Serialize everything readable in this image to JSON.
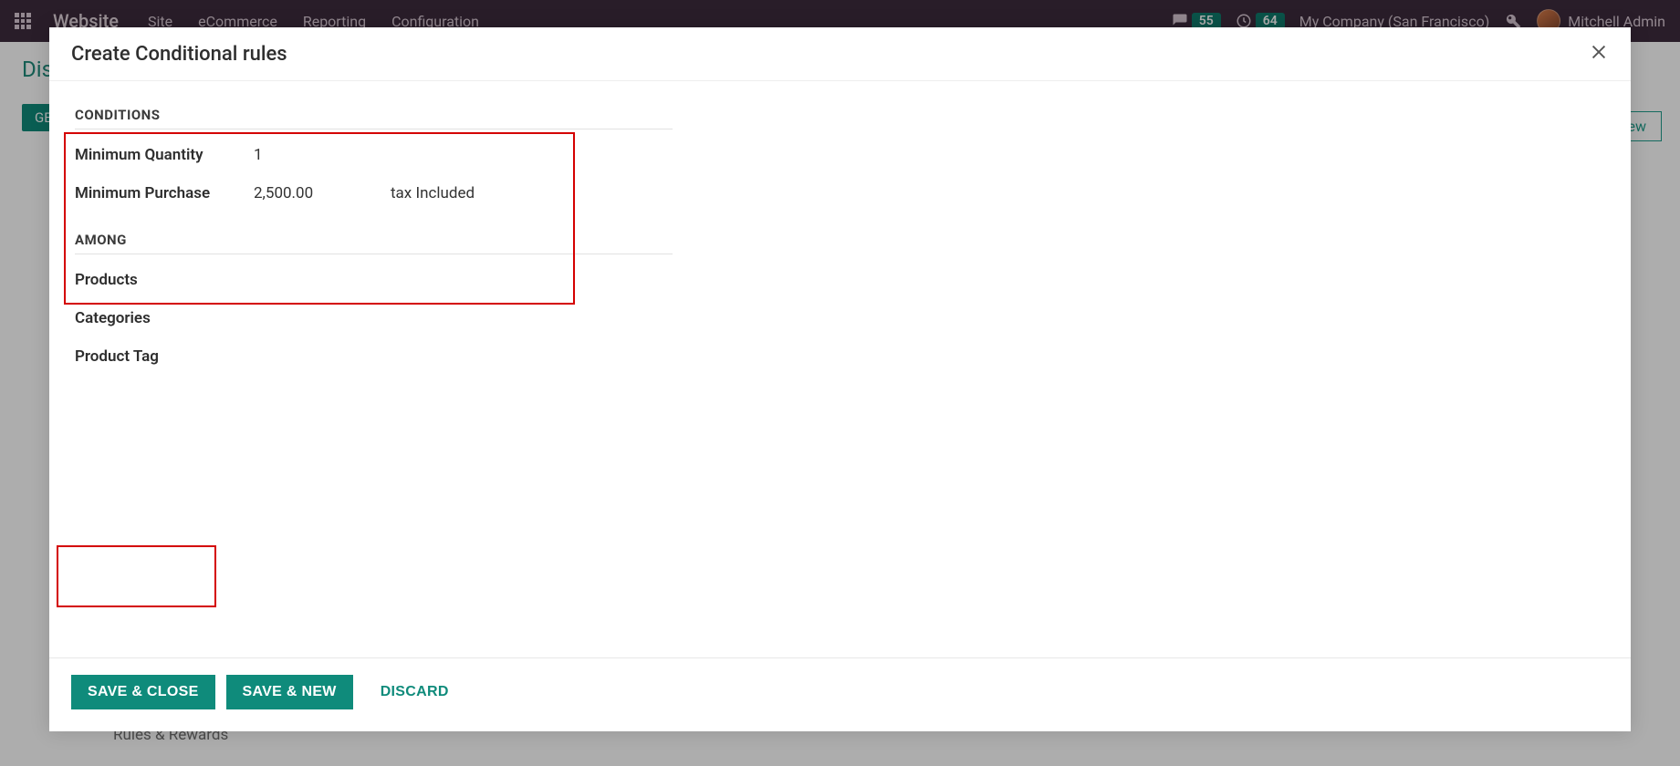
{
  "topbar": {
    "brand": "Website",
    "nav": [
      "Site",
      "eCommerce",
      "Reporting",
      "Configuration"
    ],
    "messages_badge": "55",
    "activities_badge": "64",
    "company": "My Company (San Francisco)",
    "user": "Mitchell Admin"
  },
  "background": {
    "title_fragment": "Dis",
    "button_fragment": "GE",
    "new_fragment": "ew",
    "tab": "Rules & Rewards"
  },
  "modal": {
    "title": "Create Conditional rules",
    "sections": {
      "conditions": {
        "title": "CONDITIONS",
        "min_qty_label": "Minimum Quantity",
        "min_qty_value": "1",
        "min_purchase_label": "Minimum Purchase",
        "min_purchase_value": "2,500.00",
        "tax_note": "tax Included"
      },
      "among": {
        "title": "AMONG",
        "products": "Products",
        "categories": "Categories",
        "product_tag": "Product Tag"
      }
    },
    "buttons": {
      "save_close": "SAVE & CLOSE",
      "save_new": "SAVE & NEW",
      "discard": "DISCARD"
    }
  }
}
